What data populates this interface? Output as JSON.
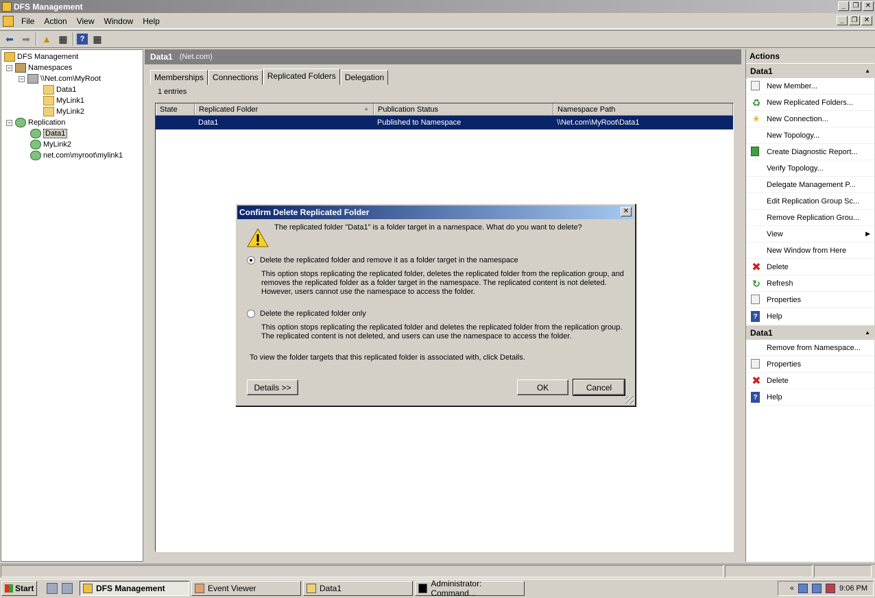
{
  "window": {
    "title": "DFS Management"
  },
  "menu": [
    "File",
    "Action",
    "View",
    "Window",
    "Help"
  ],
  "tree": {
    "root": "DFS Management",
    "namespaces": "Namespaces",
    "ns_root": "\\\\Net.com\\MyRoot",
    "ns_children": [
      "Data1",
      "MyLink1",
      "MyLink2"
    ],
    "replication": "Replication",
    "repl_children": [
      "Data1",
      "MyLink2",
      "net.com\\myroot\\mylink1"
    ]
  },
  "center": {
    "title": "Data1",
    "subtitle": "(Net.com)",
    "tabs": [
      "Memberships",
      "Connections",
      "Replicated Folders",
      "Delegation"
    ],
    "entries": "1 entries",
    "columns": [
      "State",
      "Replicated Folder",
      "Publication Status",
      "Namespace Path"
    ],
    "rows": [
      {
        "state": "",
        "folder": "Data1",
        "status": "Published to Namespace",
        "path": "\\\\Net.com\\MyRoot\\Data1"
      }
    ]
  },
  "actions": {
    "header": "Actions",
    "section1": "Data1",
    "items1": [
      "New Member...",
      "New Replicated Folders...",
      "New Connection...",
      "New Topology...",
      "Create Diagnostic Report...",
      "Verify Topology...",
      "Delegate Management P...",
      "Edit Replication Group Sc...",
      "Remove Replication Grou...",
      "View",
      "New Window from Here",
      "Delete",
      "Refresh",
      "Properties",
      "Help"
    ],
    "section2": "Data1",
    "items2": [
      "Remove from Namespace...",
      "Properties",
      "Delete",
      "Help"
    ]
  },
  "dialog": {
    "title": "Confirm Delete Replicated Folder",
    "question": "The replicated folder \"Data1\" is a folder target in a namespace. What do you want to delete?",
    "option1_label": "Delete the replicated folder and remove it as a folder target in the namespace",
    "option1_desc": "This option stops replicating the replicated folder, deletes the replicated folder from the replication group, and removes the replicated folder as a folder target in the namespace. The replicated content is not deleted. However, users cannot use the namespace to access the folder.",
    "option2_label": "Delete the replicated folder only",
    "option2_desc": "This option stops replicating the replicated folder and deletes the replicated folder from the replication group. The replicated content is not deleted, and users can use the namespace to access the folder.",
    "hint": "To view the folder targets that this replicated folder is associated with, click Details.",
    "details_button": "Details >>",
    "ok_button": "OK",
    "cancel_button": "Cancel",
    "selected_option": 1
  },
  "taskbar": {
    "start": "Start",
    "tasks": [
      "DFS Management",
      "Event Viewer",
      "Data1",
      "Administrator: Command..."
    ],
    "tray_prefix": "«",
    "clock": "9:06 PM"
  }
}
